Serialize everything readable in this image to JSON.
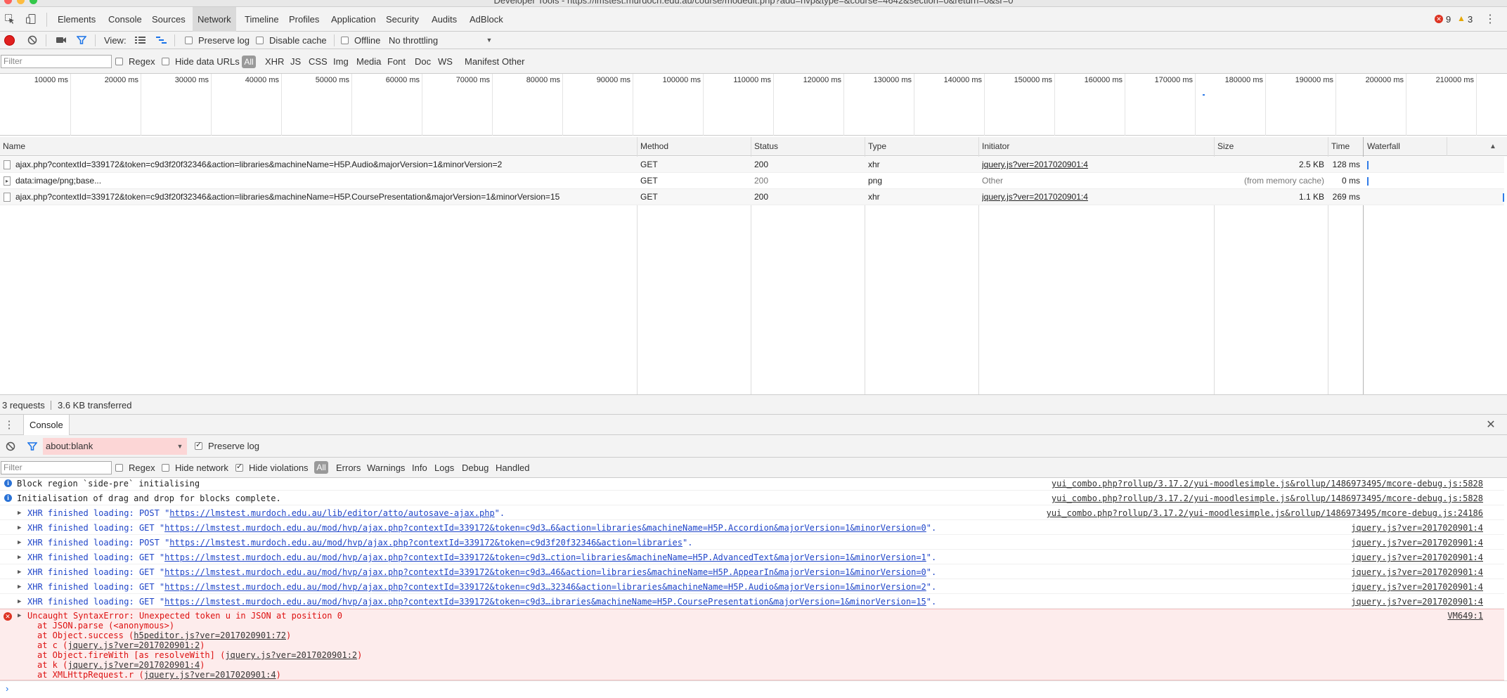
{
  "window": {
    "title": "Developer Tools - https://lmstest.murdoch.edu.au/course/modedit.php?add=hvp&type=&course=4642&section=0&return=0&sr=0"
  },
  "tabs": [
    "Elements",
    "Console",
    "Sources",
    "Network",
    "Timeline",
    "Profiles",
    "Application",
    "Security",
    "Audits",
    "AdBlock"
  ],
  "selected_tab": "Network",
  "counters": {
    "errors": "9",
    "warnings": "3"
  },
  "toolbar": {
    "view_label": "View:",
    "preserve_log": "Preserve log",
    "disable_cache": "Disable cache",
    "offline": "Offline",
    "throttle": "No throttling"
  },
  "filterbar": {
    "placeholder": "Filter",
    "regex": "Regex",
    "hide_data_urls": "Hide data URLs",
    "types": [
      "All",
      "XHR",
      "JS",
      "CSS",
      "Img",
      "Media",
      "Font",
      "Doc",
      "WS",
      "Manifest",
      "Other"
    ]
  },
  "timeline_ticks": [
    "10000 ms",
    "20000 ms",
    "30000 ms",
    "40000 ms",
    "50000 ms",
    "60000 ms",
    "70000 ms",
    "80000 ms",
    "90000 ms",
    "100000 ms",
    "110000 ms",
    "120000 ms",
    "130000 ms",
    "140000 ms",
    "150000 ms",
    "160000 ms",
    "170000 ms",
    "180000 ms",
    "190000 ms",
    "200000 ms",
    "210000 ms"
  ],
  "table": {
    "headers": {
      "name": "Name",
      "method": "Method",
      "status": "Status",
      "type": "Type",
      "initiator": "Initiator",
      "size": "Size",
      "time": "Time",
      "waterfall": "Waterfall"
    },
    "rows": [
      {
        "name": "ajax.php?contextId=339172&token=c9d3f20f32346&action=libraries&machineName=H5P.Audio&majorVersion=1&minorVersion=2",
        "method": "GET",
        "status": "200",
        "type": "xhr",
        "initiator": "jquery.js?ver=2017020901:4",
        "size": "2.5 KB",
        "time": "128 ms"
      },
      {
        "name": "data:image/png;base...",
        "method": "GET",
        "status": "200",
        "type": "png",
        "initiator": "Other",
        "size": "(from memory cache)",
        "time": "0 ms"
      },
      {
        "name": "ajax.php?contextId=339172&token=c9d3f20f32346&action=libraries&machineName=H5P.CoursePresentation&majorVersion=1&minorVersion=15",
        "method": "GET",
        "status": "200",
        "type": "xhr",
        "initiator": "jquery.js?ver=2017020901:4",
        "size": "1.1 KB",
        "time": "269 ms"
      }
    ]
  },
  "summary": {
    "requests": "3 requests",
    "transferred": "3.6 KB transferred"
  },
  "drawer": {
    "tab": "Console",
    "context": "about:blank",
    "preserve_log": "Preserve log",
    "filter_placeholder": "Filter",
    "regex": "Regex",
    "hide_network": "Hide network",
    "hide_violations": "Hide violations",
    "levels": [
      "All",
      "Errors",
      "Warnings",
      "Info",
      "Logs",
      "Debug",
      "Handled"
    ]
  },
  "console_lines": [
    {
      "msg": "Block region `side-pre` initialising",
      "src": "yui_combo.php?rollup/3.17.2/yui-moodlesimple.js&rollup/1486973495/mcore-debug.js:5828"
    },
    {
      "msg": "Initialisation of drag and drop for blocks complete.",
      "src": "yui_combo.php?rollup/3.17.2/yui-moodlesimple.js&rollup/1486973495/mcore-debug.js:5828"
    },
    {
      "prefix": "XHR finished loading: POST \"",
      "url": "https://lmstest.murdoch.edu.au/lib/editor/atto/autosave-ajax.php",
      "suffix": "\".",
      "src": "yui_combo.php?rollup/3.17.2/yui-moodlesimple.js&rollup/1486973495/mcore-debug.js:24186"
    },
    {
      "prefix": "XHR finished loading: GET \"",
      "url": "https://lmstest.murdoch.edu.au/mod/hvp/ajax.php?contextId=339172&token=c9d3…6&action=libraries&machineName=H5P.Accordion&majorVersion=1&minorVersion=0",
      "suffix": "\".",
      "src": "jquery.js?ver=2017020901:4"
    },
    {
      "prefix": "XHR finished loading: POST \"",
      "url": "https://lmstest.murdoch.edu.au/mod/hvp/ajax.php?contextId=339172&token=c9d3f20f32346&action=libraries",
      "suffix": "\".",
      "src": "jquery.js?ver=2017020901:4"
    },
    {
      "prefix": "XHR finished loading: GET \"",
      "url": "https://lmstest.murdoch.edu.au/mod/hvp/ajax.php?contextId=339172&token=c9d3…ction=libraries&machineName=H5P.AdvancedText&majorVersion=1&minorVersion=1",
      "suffix": "\".",
      "src": "jquery.js?ver=2017020901:4"
    },
    {
      "prefix": "XHR finished loading: GET \"",
      "url": "https://lmstest.murdoch.edu.au/mod/hvp/ajax.php?contextId=339172&token=c9d3…46&action=libraries&machineName=H5P.AppearIn&majorVersion=1&minorVersion=0",
      "suffix": "\".",
      "src": "jquery.js?ver=2017020901:4"
    },
    {
      "prefix": "XHR finished loading: GET \"",
      "url": "https://lmstest.murdoch.edu.au/mod/hvp/ajax.php?contextId=339172&token=c9d3…32346&action=libraries&machineName=H5P.Audio&majorVersion=1&minorVersion=2",
      "suffix": "\".",
      "src": "jquery.js?ver=2017020901:4"
    },
    {
      "prefix": "XHR finished loading: GET \"",
      "url": "https://lmstest.murdoch.edu.au/mod/hvp/ajax.php?contextId=339172&token=c9d3…ibraries&machineName=H5P.CoursePresentation&majorVersion=1&minorVersion=15",
      "suffix": "\".",
      "src": "jquery.js?ver=2017020901:4"
    }
  ],
  "error": {
    "msg": "Uncaught SyntaxError: Unexpected token u in JSON at position 0",
    "src": "VM649:1",
    "stack": [
      {
        "pre": "at JSON.parse (<anonymous>)",
        "link": "",
        "post": ""
      },
      {
        "pre": "at Object.success (",
        "link": "h5peditor.js?ver=2017020901:72",
        "post": ")"
      },
      {
        "pre": "at c (",
        "link": "jquery.js?ver=2017020901:2",
        "post": ")"
      },
      {
        "pre": "at Object.fireWith [as resolveWith] (",
        "link": "jquery.js?ver=2017020901:2",
        "post": ")"
      },
      {
        "pre": "at k (",
        "link": "jquery.js?ver=2017020901:4",
        "post": ")"
      },
      {
        "pre": "at XMLHttpRequest.r (",
        "link": "jquery.js?ver=2017020901:4",
        "post": ")"
      }
    ]
  },
  "colors": {
    "accent": "#3b82f6",
    "error_bg": "#fdecec",
    "record": "#e0201f",
    "filter": "#1a73e8"
  }
}
